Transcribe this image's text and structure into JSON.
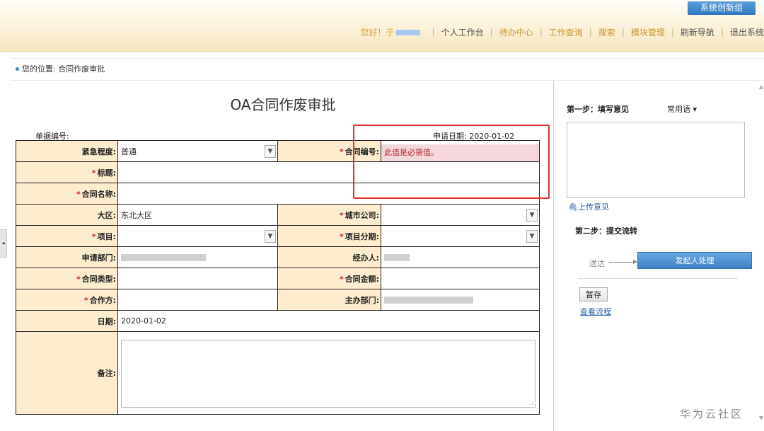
{
  "header": {
    "system_button": "系统创新组",
    "greeting": "您好！于",
    "nav": [
      {
        "label": "个人工作台",
        "highlight": false
      },
      {
        "label": "待办中心",
        "highlight": true
      },
      {
        "label": "工作查询",
        "highlight": true
      },
      {
        "label": "搜索",
        "highlight": true
      },
      {
        "label": "模块管理",
        "highlight": true
      },
      {
        "label": "刷新导航",
        "highlight": false
      },
      {
        "label": "退出系统",
        "highlight": false
      }
    ]
  },
  "breadcrumb": "您的位置: 合同作废审批",
  "form": {
    "title": "OA合同作废审批",
    "doc_no_label": "单据编号:",
    "apply_date_label": "申请日期:",
    "apply_date": "2020-01-02",
    "fields": {
      "urgency_label": "紧急程度:",
      "urgency_value": "普通",
      "contract_no_label": "合同编号:",
      "contract_no_error": "此值是必需值。",
      "title_label": "标题:",
      "contract_name_label": "合同名称:",
      "region_label": "大区:",
      "region_value": "东北大区",
      "city_company_label": "城市公司:",
      "project_label": "项目:",
      "project_phase_label": "项目分期:",
      "dept_label": "申请部门:",
      "handler_label": "经办人:",
      "contract_type_label": "合同类型:",
      "contract_amount_label": "合同金额:",
      "partner_label": "合作方:",
      "host_dept_label": "主办部门:",
      "date_label": "日期:",
      "date_value": "2020-01-02",
      "remark_label": "备注:"
    }
  },
  "panel": {
    "step1": "第一步：填写意见",
    "common_phrases": "常用语",
    "upload": "上传意见",
    "step2": "第二步：提交流转",
    "send_to": "送达",
    "send_button": "发起人处理",
    "save_button": "暂存",
    "view_flow": "查看流程"
  },
  "watermark": "华为云社区"
}
